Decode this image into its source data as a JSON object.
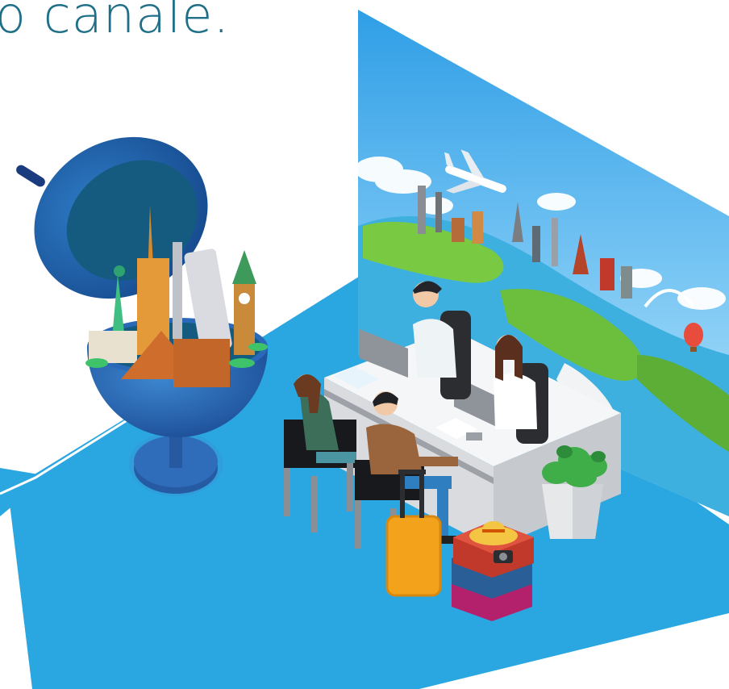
{
  "caption": "o canale.",
  "colors": {
    "floor": "#2aa6e0",
    "floor_edge": "#1f86c2",
    "wall_sky": "#4fb2ee",
    "globe_outer": "#2a69b7",
    "globe_inner": "#155b7f",
    "desk": "#e9eaec",
    "caption_text": "#1f6f88"
  },
  "illustration": {
    "subject": "travel-agency-counter",
    "elements": [
      "globe-with-world-landmarks",
      "world-map-mural",
      "reception-desk",
      "two-agents",
      "two-customers",
      "yellow-suitcase",
      "stacked-suitcases-with-hat-and-camera",
      "potted-plant",
      "airplane",
      "hot-air-balloon"
    ]
  }
}
